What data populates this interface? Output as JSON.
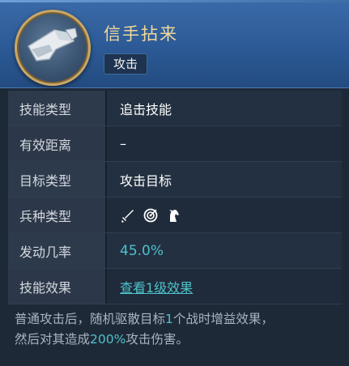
{
  "skill": {
    "name": "信手拈来",
    "tag": "攻击",
    "icon": "gauntlet-icon"
  },
  "rows": [
    {
      "label": "技能类型",
      "value": "追击技能"
    },
    {
      "label": "有效距离",
      "value": "–"
    },
    {
      "label": "目标类型",
      "value": "攻击目标"
    },
    {
      "label": "兵种类型",
      "value": "",
      "icons": [
        "sword-icon",
        "bow-target-icon",
        "horse-icon"
      ]
    },
    {
      "label": "发动几率",
      "value": "45.0%"
    },
    {
      "label": "技能效果",
      "value": "查看1级效果"
    }
  ],
  "description": {
    "p1": "普通攻击后，随机驱散目标",
    "n1": "1",
    "p2": "个战时增益效果，",
    "p3": "然后对其造成",
    "n2": "200%",
    "p4": "攻击伤害。"
  },
  "colors": {
    "accent": "#4ec2c9",
    "title": "#f0d89a",
    "header": "#2c5a96"
  }
}
